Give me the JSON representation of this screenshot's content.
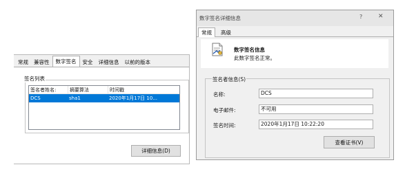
{
  "file_properties": {
    "tabs": [
      "常规",
      "兼容性",
      "数字签名",
      "安全",
      "详细信息",
      "以前的版本"
    ],
    "active_tab_index": 2,
    "signature_list_label": "签名列表",
    "columns": [
      "签名者姓名:",
      "摘要算法",
      "时间戳"
    ],
    "rows": [
      {
        "signer": "DCS",
        "algorithm": "sha1",
        "timestamp": "2020年1月17日 10..."
      }
    ],
    "details_button": "详细信息(D)"
  },
  "signature_details": {
    "window_title": "数字签名详细信息",
    "help": "?",
    "close": "✕",
    "tabs": [
      "常规",
      "高级"
    ],
    "active_tab_index": 0,
    "info_title": "数字签名信息",
    "info_status": "此数字签名正常。",
    "signer_info_label": "签名者信息(S)",
    "fields": {
      "name_label": "名称:",
      "name_value": "DCS",
      "email_label": "电子邮件:",
      "email_value": "不可用",
      "time_label": "签名时间:",
      "time_value": "2020年1月17日 10:22:20"
    },
    "view_cert_button": "查看证书(V)"
  },
  "colors": {
    "selection": "#0078d7",
    "dialog_bg": "#f0f0f0",
    "titlebar_bg": "#e6e6e6"
  }
}
